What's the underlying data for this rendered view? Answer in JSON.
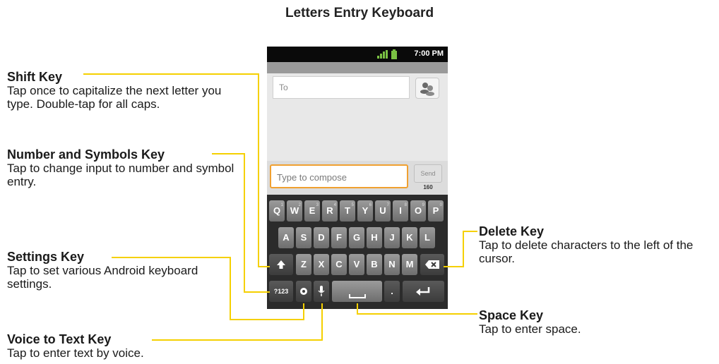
{
  "title": "Letters Entry Keyboard",
  "status_bar": {
    "time": "7:00 PM"
  },
  "to_field": {
    "placeholder": "To"
  },
  "compose": {
    "placeholder": "Type to compose",
    "send_label": "Send",
    "char_count": "160"
  },
  "keyboard": {
    "row1": [
      "Q",
      "W",
      "E",
      "R",
      "T",
      "Y",
      "U",
      "I",
      "O",
      "P"
    ],
    "row1_alt": [
      "1",
      "2",
      "3",
      "4",
      "5",
      "6",
      "7",
      "8",
      "9",
      "0"
    ],
    "row2": [
      "A",
      "S",
      "D",
      "F",
      "G",
      "H",
      "J",
      "K",
      "L"
    ],
    "row3": [
      "Z",
      "X",
      "C",
      "V",
      "B",
      "N",
      "M"
    ],
    "symbols_label": "?123",
    "period_label": "."
  },
  "callouts": {
    "shift": {
      "heading": "Shift Key",
      "desc": "Tap once to capitalize the next letter you type. Double-tap for all caps."
    },
    "numbers": {
      "heading": "Number and Symbols Key",
      "desc": "Tap to change input to number and symbol entry."
    },
    "settings": {
      "heading": "Settings Key",
      "desc": "Tap to set various Android keyboard settings."
    },
    "voice": {
      "heading": "Voice to Text Key",
      "desc": "Tap to enter text by voice."
    },
    "delete": {
      "heading": "Delete Key",
      "desc": "Tap to delete characters to the left of the cursor."
    },
    "space": {
      "heading": "Space Key",
      "desc": "Tap to enter space."
    }
  },
  "colors": {
    "leader": "#f5d000",
    "compose_border": "#f0a030"
  },
  "icons": [
    "signal-icon",
    "battery-icon",
    "contact-icon",
    "shift-icon",
    "delete-icon",
    "settings-icon",
    "mic-icon",
    "enter-icon"
  ]
}
